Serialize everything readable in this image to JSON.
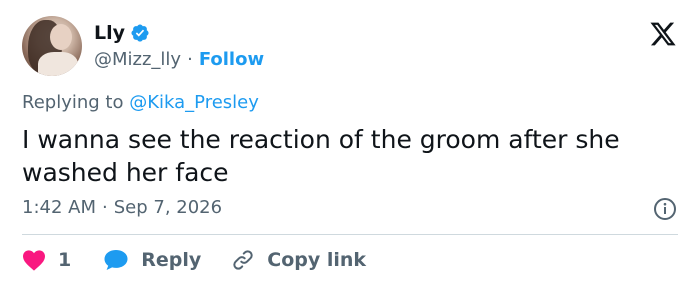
{
  "author": {
    "name": "Lly",
    "handle": "@Mizz_lly",
    "separator": "·",
    "follow_label": "Follow",
    "verified": true
  },
  "reply_context": {
    "prefix": "Replying to",
    "mention": "@Kika_Presley"
  },
  "tweet": {
    "text": "I wanna see the reaction of the groom after she washed her face",
    "time": "1:42 AM",
    "separator": "·",
    "date": "Sep 7, 2026"
  },
  "actions": {
    "like_count": "1",
    "reply_label": "Reply",
    "copy_link_label": "Copy link"
  },
  "icons": {
    "logo": "x-logo-icon",
    "verified": "verified-badge-icon",
    "info": "info-icon",
    "like": "heart-icon",
    "reply": "speech-bubble-icon",
    "copy": "link-icon"
  },
  "colors": {
    "accent": "#1d9bf0",
    "text": "#0f1419",
    "muted": "#536471",
    "like": "#f91880",
    "divider": "#cfd9de"
  }
}
